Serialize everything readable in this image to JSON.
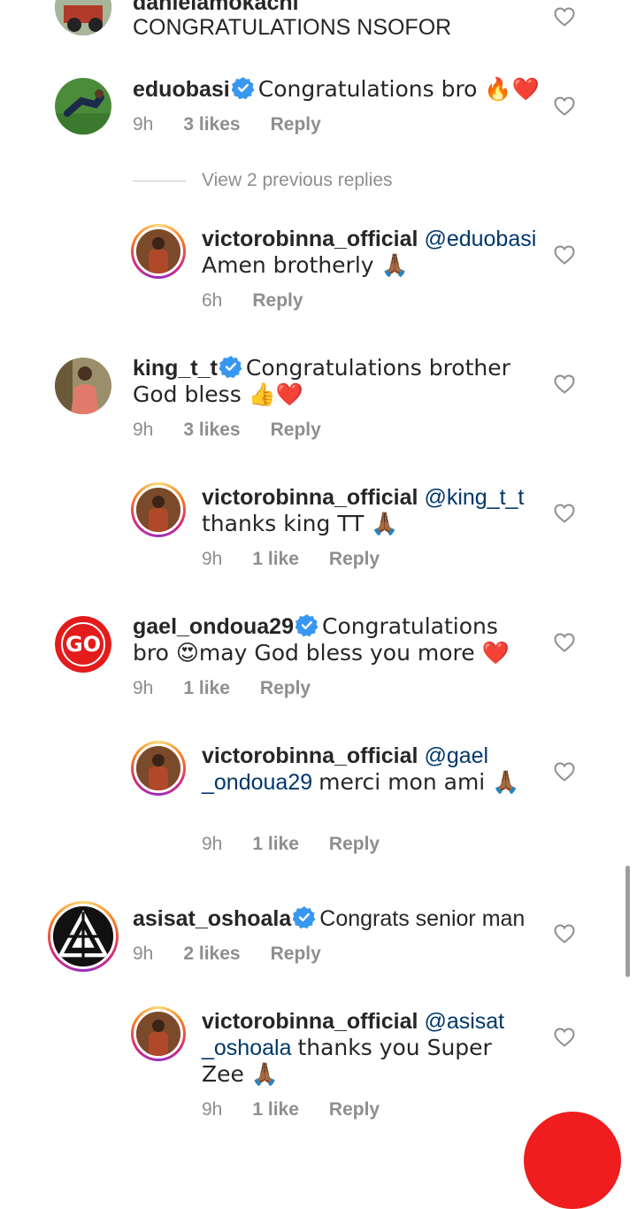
{
  "comments": [
    {
      "user": "danielamokachi",
      "text": "CONGRATULATIONS NSOFOR"
    },
    {
      "user": "eduobasi",
      "text": "Congratulations bro 🔥❤️",
      "time": "9h",
      "likes": "3 likes",
      "reply": "Reply"
    },
    {
      "user": "victorobinna_official",
      "mention": "@eduobasi",
      "text": "Amen brotherly 🙏🏾",
      "time": "6h",
      "reply": "Reply"
    },
    {
      "user": "king_t_t",
      "text": "Congratulations brother God bless 👍❤️",
      "time": "9h",
      "likes": "3 likes",
      "reply": "Reply"
    },
    {
      "user": "victorobinna_official",
      "mention": "@king_t_t",
      "text": "thanks king TT 🙏🏾",
      "time": "9h",
      "likes": "1 like",
      "reply": "Reply"
    },
    {
      "user": "gael_ondoua29",
      "text": "Congratulations bro 😍may God bless you more ❤️",
      "time": "9h",
      "likes": "1 like",
      "reply": "Reply"
    },
    {
      "user": "victorobinna_official",
      "mention": "@gael _ondoua29",
      "text": "merci mon ami 🙏🏾",
      "time": "9h",
      "likes": "1 like",
      "reply": "Reply"
    },
    {
      "user": "asisat_oshoala",
      "text": "Congrats senior man",
      "time": "9h",
      "likes": "2 likes",
      "reply": "Reply"
    },
    {
      "user": "victorobinna_official",
      "mention": "@asisat _oshoala",
      "text": "thanks you Super Zee 🙏🏾",
      "time": "9h",
      "likes": "1 like",
      "reply": "Reply"
    }
  ],
  "view_previous_replies": "View 2 previous replies",
  "colors": {
    "mention": "#00376b",
    "meta": "#8e8e8e",
    "verified": "#3897f0",
    "fab": "#ef1d1d"
  },
  "icons": {
    "verified": "verified-badge-icon",
    "like": "heart-outline-icon"
  }
}
